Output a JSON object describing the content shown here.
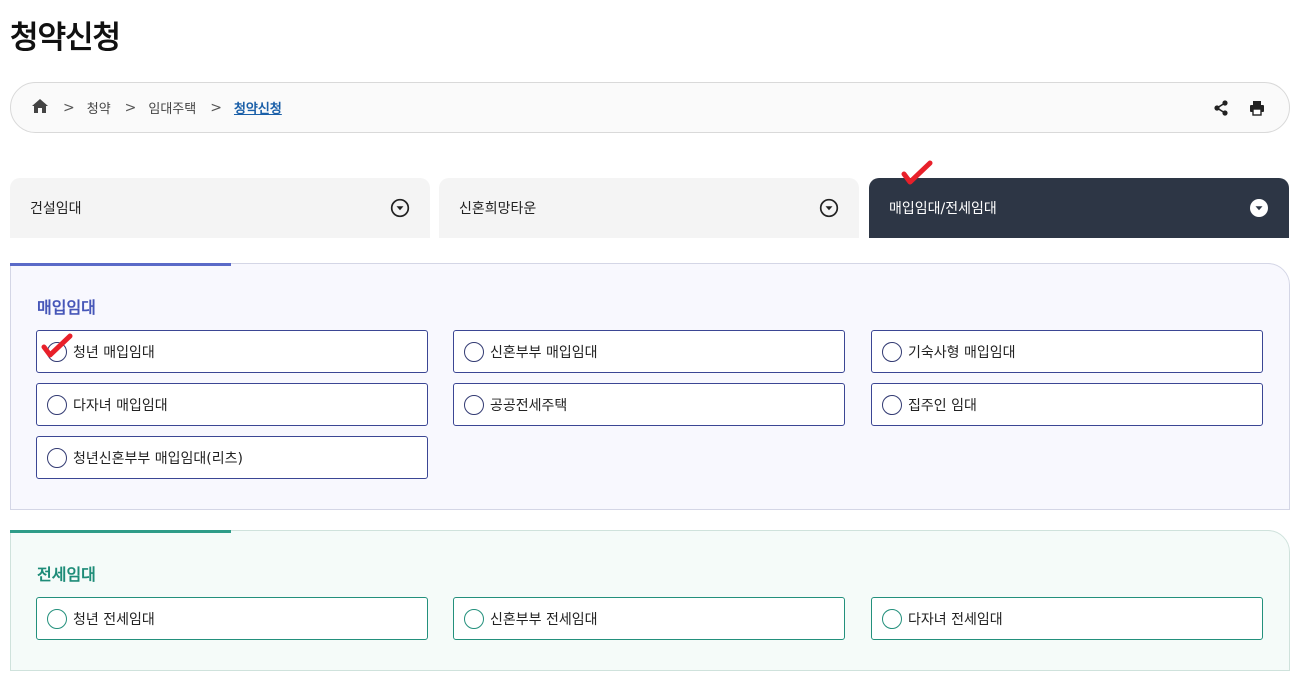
{
  "page": {
    "title": "청약신청"
  },
  "breadcrumb": {
    "home_icon": "home-icon",
    "items": [
      "청약",
      "임대주택",
      "청약신청"
    ],
    "separator": ">"
  },
  "tools": {
    "share_icon": "share-icon",
    "print_icon": "print-icon"
  },
  "tabs": [
    {
      "label": "건설임대",
      "active": false
    },
    {
      "label": "신혼희망타운",
      "active": false
    },
    {
      "label": "매입임대/전세임대",
      "active": true
    }
  ],
  "sections": [
    {
      "title": "매입임대",
      "accent": "#4656b8",
      "options": [
        "청년 매입임대",
        "신혼부부 매입임대",
        "기숙사형 매입임대",
        "다자녀 매입임대",
        "공공전세주택",
        "집주인 임대",
        "청년신혼부부 매입임대(리츠)"
      ]
    },
    {
      "title": "전세임대",
      "accent": "#1e8c78",
      "options": [
        "청년 전세임대",
        "신혼부부 전세임대",
        "다자녀 전세임대"
      ]
    }
  ],
  "colors": {
    "active_tab": "#2d3645",
    "check_mark": "#e8202a"
  }
}
